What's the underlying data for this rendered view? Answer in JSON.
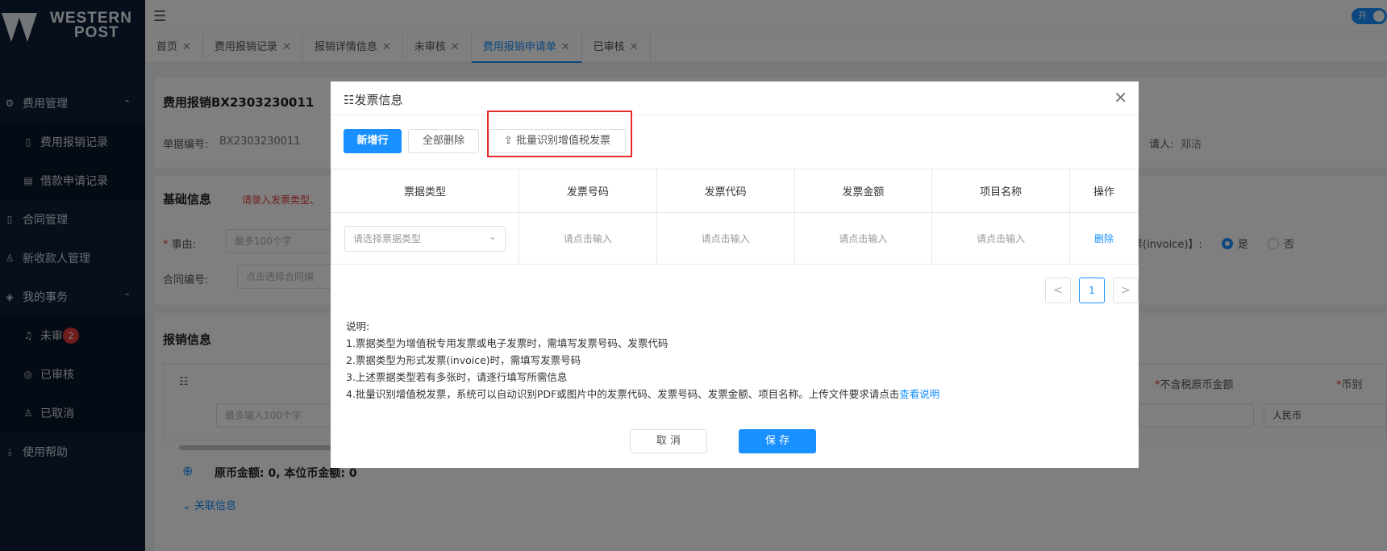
{
  "brand": {
    "line1": "WESTERN",
    "line2": "POST"
  },
  "sidebar": {
    "items": [
      {
        "label": "费用管理",
        "icon": "gear-icon",
        "arrow": "⌃"
      },
      {
        "label": "费用报销记录",
        "icon": "document-icon"
      },
      {
        "label": "借款申请记录",
        "icon": "list-icon"
      },
      {
        "label": "合同管理",
        "icon": "contract-icon"
      },
      {
        "label": "新收款人管理",
        "icon": "user-icon"
      },
      {
        "label": "我的事务",
        "icon": "tag-icon",
        "arrow": "⌃"
      },
      {
        "label": "未审",
        "icon": "bell-icon",
        "badge": "2"
      },
      {
        "label": "已审核",
        "icon": "shield-icon"
      },
      {
        "label": "已取消",
        "icon": "user-cancel-icon"
      },
      {
        "label": "使用帮助",
        "icon": "download-icon"
      }
    ]
  },
  "topbar": {
    "toggle_label": "开"
  },
  "tabs": [
    {
      "label": "首页"
    },
    {
      "label": "费用报销记录"
    },
    {
      "label": "报销详情信息"
    },
    {
      "label": "未审核"
    },
    {
      "label": "费用报销申请单"
    },
    {
      "label": "已审核"
    }
  ],
  "background": {
    "doc_title": "费用报销BX2303230011",
    "doc_no_label": "单据编号:",
    "doc_no_value": "BX2303230011",
    "applicant_label": "请人:",
    "applicant_value": "郑洁",
    "basic_title": "基础信息",
    "basic_hint": "请录入发票类型、",
    "reason_label": "事由:",
    "reason_placeholder": "最多100个字",
    "contract_label": "合同编号:",
    "contract_placeholder": "点击选择合同编",
    "invoice_question": "票(invoice)】:",
    "yes_label": "是",
    "no_label": "否",
    "expense_title": "报销信息",
    "col_amount": "不含税原币金额",
    "col_currency": "币别",
    "row_placeholder": "最多输入100个字",
    "currency_value": "人民币",
    "totals": "原币金额: 0, 本位币金额: 0",
    "related": "关联信息"
  },
  "modal": {
    "title": "发票信息",
    "add_row": "新增行",
    "delete_all": "全部删除",
    "batch_recognize": "批量识别增值税发票",
    "columns": [
      "票据类型",
      "发票号码",
      "发票代码",
      "发票金额",
      "项目名称",
      "操作"
    ],
    "row": {
      "type_placeholder": "请选择票据类型",
      "invoice_no": "请点击输入",
      "invoice_code": "请点击输入",
      "amount": "请点击输入",
      "project": "请点击输入",
      "action": "删除"
    },
    "pager": {
      "prev": "<",
      "page": "1",
      "next": ">"
    },
    "notes": {
      "heading": "说明:",
      "n1": "1.票据类型为增值税专用发票或电子发票时，需填写发票号码、发票代码",
      "n2": "2.票据类型为形式发票(invoice)时，需填写发票号码",
      "n3": "3.上述票据类型若有多张时，请逐行填写所需信息",
      "n4": "4.批量识别增值税发票，系统可以自动识别PDF或图片中的发票代码、发票号码、发票金额、项目名称。上传文件要求请点击",
      "n4_link": "查看说明"
    },
    "cancel": "取 消",
    "save": "保 存"
  }
}
